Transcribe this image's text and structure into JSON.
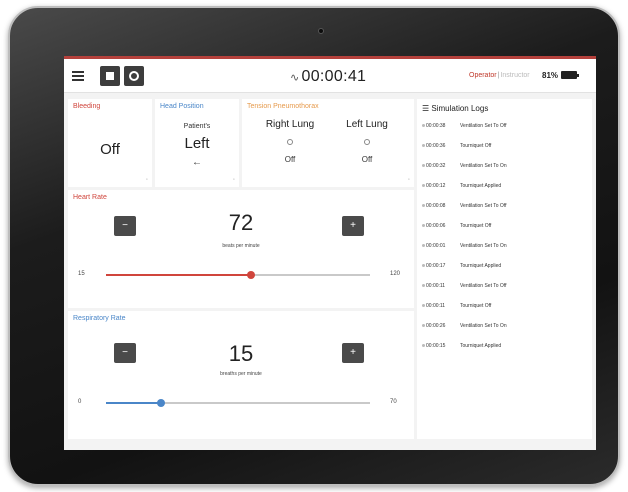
{
  "topbar": {
    "timer": "00:00:41",
    "mode_operator": "Operator",
    "mode_instructor": "Instructor",
    "battery_text": "81%"
  },
  "bleeding": {
    "title": "Bleeding",
    "state": "Off"
  },
  "head_position": {
    "title": "Head Position",
    "sub": "Patient's",
    "state": "Left",
    "arrow": "←"
  },
  "tension": {
    "title": "Tension Pneumothorax",
    "right_label": "Right Lung",
    "right_state": "Off",
    "left_label": "Left Lung",
    "left_state": "Off"
  },
  "heart_rate": {
    "title": "Heart Rate",
    "value": "72",
    "unit": "beats per minute",
    "min": "15",
    "max": "120",
    "level": 0.55
  },
  "respiratory_rate": {
    "title": "Respiratory Rate",
    "value": "15",
    "unit": "breaths per minute",
    "min": "0",
    "max": "70",
    "level": 0.21
  },
  "log": {
    "title": "Simulation Logs",
    "entries": [
      {
        "time": "00:00:38",
        "event": "Ventilation Set To Off"
      },
      {
        "time": "00:00:36",
        "event": "Tourniquet Off"
      },
      {
        "time": "00:00:32",
        "event": "Ventilation Set To On"
      },
      {
        "time": "00:00:12",
        "event": "Tourniquet Applied"
      },
      {
        "time": "00:00:08",
        "event": "Ventilation Set To Off"
      },
      {
        "time": "00:00:06",
        "event": "Tourniquet Off"
      },
      {
        "time": "00:00:01",
        "event": "Ventilation Set To On"
      },
      {
        "time": "00:00:17",
        "event": "Tourniquet Applied"
      },
      {
        "time": "00:00:11",
        "event": "Ventilation Set To Off"
      },
      {
        "time": "00:00:11",
        "event": "Tourniquet Off"
      },
      {
        "time": "00:00:26",
        "event": "Ventilation Set To On"
      },
      {
        "time": "00:00:15",
        "event": "Tourniquet Applied"
      }
    ]
  },
  "colors": {
    "accent_red": "#d0453c",
    "accent_blue": "#4a86c8",
    "accent_orange": "#e69a4c"
  }
}
